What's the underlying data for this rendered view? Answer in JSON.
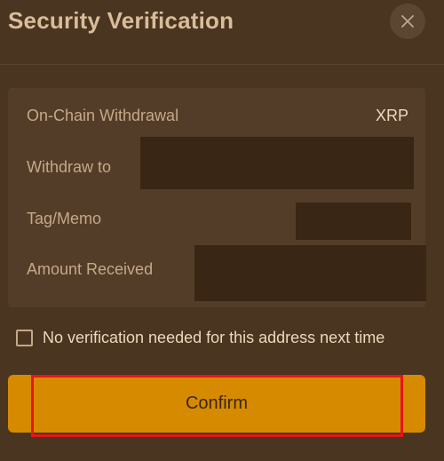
{
  "dialog": {
    "title": "Security Verification",
    "close_icon": "close-icon"
  },
  "details": {
    "withdrawal_type_label": "On-Chain Withdrawal",
    "currency": "XRP",
    "withdraw_to_label": "Withdraw to",
    "tag_memo_label": "Tag/Memo",
    "amount_received_label": "Amount Received"
  },
  "options": {
    "skip_verification_checked": false,
    "skip_verification_label": "No verification needed for this address next time"
  },
  "actions": {
    "confirm_label": "Confirm"
  },
  "colors": {
    "background": "#4a3520",
    "panel": "#543d28",
    "accent": "#d68a00",
    "highlight": "#e8141c"
  }
}
